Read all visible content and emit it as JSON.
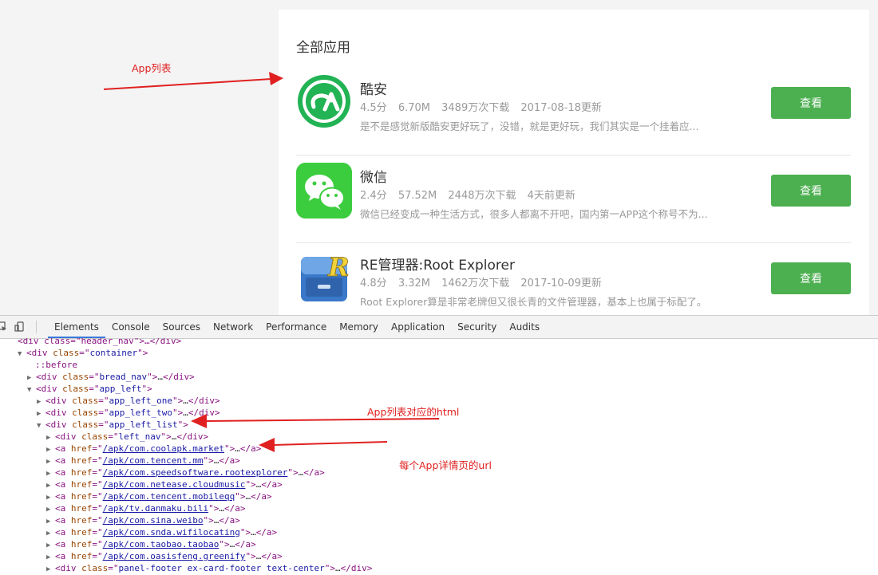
{
  "section_title": "全部应用",
  "apps": [
    {
      "name": "酷安",
      "rating": "4.5分",
      "size": "6.70M",
      "downloads": "3489万次下载",
      "updated": "2017-08-18更新",
      "desc": "是不是感觉新版酷安更好玩了，没错，就是更好玩，我们其实是一个挂着应...",
      "icon": "coolapk-icon",
      "button": "查看"
    },
    {
      "name": "微信",
      "rating": "2.4分",
      "size": "57.52M",
      "downloads": "2448万次下载",
      "updated": "4天前更新",
      "desc": "微信已经变成一种生活方式，很多人都离不开吧，国内第一APP这个称号不为...",
      "icon": "wechat-icon",
      "button": "查看"
    },
    {
      "name": "RE管理器:Root Explorer",
      "rating": "4.8分",
      "size": "3.32M",
      "downloads": "1462万次下载",
      "updated": "2017-10-09更新",
      "desc": "Root Explorer算是非常老牌但又很长青的文件管理器，基本上也属于标配了。",
      "icon": "root-explorer-icon",
      "button": "查看"
    }
  ],
  "annotations": {
    "app_list": "App列表",
    "app_list_html": "App列表对应的html",
    "detail_url": "每个App详情页的url"
  },
  "colors": {
    "accent_button": "#4caf50",
    "annotation": "#e02020"
  },
  "devtools": {
    "tabs": [
      "Elements",
      "Console",
      "Sources",
      "Network",
      "Performance",
      "Memory",
      "Application",
      "Security",
      "Audits"
    ],
    "active_tab": "Elements",
    "lines": [
      {
        "kind": "partial",
        "text": "<div class=\"header_nav\">…</div>"
      },
      {
        "kind": "open",
        "tag": "div",
        "attr": "class",
        "val": "container",
        "expanded": true
      },
      {
        "kind": "pseudo",
        "text": "::before"
      },
      {
        "kind": "collapsed",
        "tag": "div",
        "attr": "class",
        "val": "bread_nav"
      },
      {
        "kind": "open",
        "tag": "div",
        "attr": "class",
        "val": "app_left",
        "expanded": true
      },
      {
        "kind": "collapsed",
        "tag": "div",
        "attr": "class",
        "val": "app_left_one"
      },
      {
        "kind": "collapsed",
        "tag": "div",
        "attr": "class",
        "val": "app_left_two"
      },
      {
        "kind": "open",
        "tag": "div",
        "attr": "class",
        "val": "app_left_list",
        "expanded": true
      },
      {
        "kind": "collapsed",
        "tag": "div",
        "attr": "class",
        "val": "left_nav"
      },
      {
        "kind": "link",
        "href": "/apk/com.coolapk.market"
      },
      {
        "kind": "link",
        "href": "/apk/com.tencent.mm"
      },
      {
        "kind": "link",
        "href": "/apk/com.speedsoftware.rootexplorer"
      },
      {
        "kind": "link",
        "href": "/apk/com.netease.cloudmusic"
      },
      {
        "kind": "link",
        "href": "/apk/com.tencent.mobileqq"
      },
      {
        "kind": "link",
        "href": "/apk/tv.danmaku.bili"
      },
      {
        "kind": "link",
        "href": "/apk/com.sina.weibo"
      },
      {
        "kind": "link",
        "href": "/apk/com.snda.wifilocating"
      },
      {
        "kind": "link",
        "href": "/apk/com.taobao.taobao"
      },
      {
        "kind": "link",
        "href": "/apk/com.oasisfeng.greenify"
      },
      {
        "kind": "collapsed",
        "tag": "div",
        "attr": "class",
        "val": "panel-footer ex-card-footer text-center"
      }
    ]
  }
}
